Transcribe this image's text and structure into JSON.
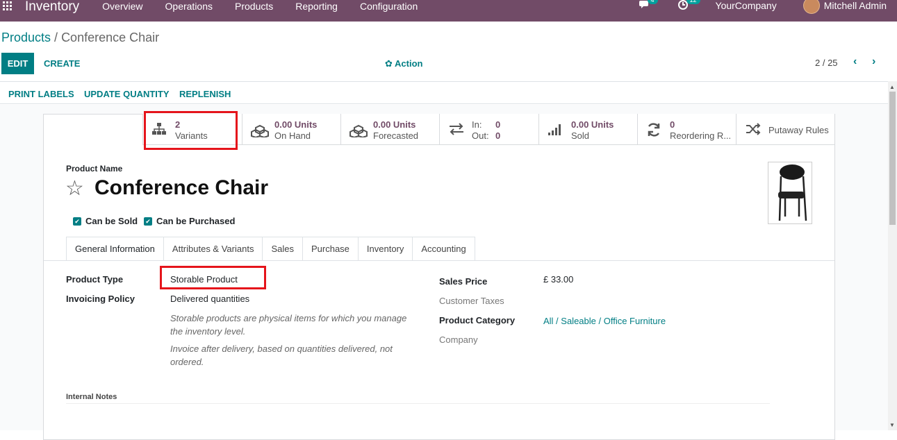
{
  "navbar": {
    "app_title": "Inventory",
    "menu": [
      "Overview",
      "Operations",
      "Products",
      "Reporting",
      "Configuration"
    ],
    "messages_count": "4",
    "activities_count": "12",
    "company": "YourCompany",
    "user": "Mitchell Admin"
  },
  "breadcrumb": {
    "parent": "Products",
    "separator": " / ",
    "current": "Conference Chair"
  },
  "controls": {
    "edit": "EDIT",
    "create": "CREATE",
    "action": "Action",
    "pager": "2 / 25"
  },
  "statusbar": {
    "print_labels": "PRINT LABELS",
    "update_quantity": "UPDATE QUANTITY",
    "replenish": "REPLENISH"
  },
  "smart_buttons": {
    "variants": {
      "value": "2",
      "label": "Variants"
    },
    "on_hand": {
      "value": "0.00 Units",
      "label": "On Hand"
    },
    "forecasted": {
      "value": "0.00 Units",
      "label": "Forecasted"
    },
    "in_out": {
      "in_label": "In:",
      "in_value": "0",
      "out_label": "Out:",
      "out_value": "0"
    },
    "sold": {
      "value": "0.00 Units",
      "label": "Sold"
    },
    "reordering": {
      "value": "0",
      "label": "Reordering R..."
    },
    "putaway": {
      "label": "Putaway Rules"
    }
  },
  "product": {
    "name_label": "Product Name",
    "name": "Conference Chair",
    "can_be_sold": "Can be Sold",
    "can_be_purchased": "Can be Purchased"
  },
  "tabs": [
    "General Information",
    "Attributes & Variants",
    "Sales",
    "Purchase",
    "Inventory",
    "Accounting"
  ],
  "fields": {
    "product_type_label": "Product Type",
    "product_type": "Storable Product",
    "invoicing_policy_label": "Invoicing Policy",
    "invoicing_policy": "Delivered quantities",
    "help_storable": "Storable products are physical items for which you manage the inventory level.",
    "help_invoice": "Invoice after delivery, based on quantities delivered, not ordered.",
    "sales_price_label": "Sales Price",
    "sales_price": "£ 33.00",
    "customer_taxes_label": "Customer Taxes",
    "product_category_label": "Product Category",
    "product_category": "All / Saleable / Office Furniture",
    "company_label": "Company",
    "internal_notes_label": "Internal Notes"
  },
  "colors": {
    "brand": "#714b67",
    "accent": "#017e84",
    "highlight": "#e5141b"
  }
}
